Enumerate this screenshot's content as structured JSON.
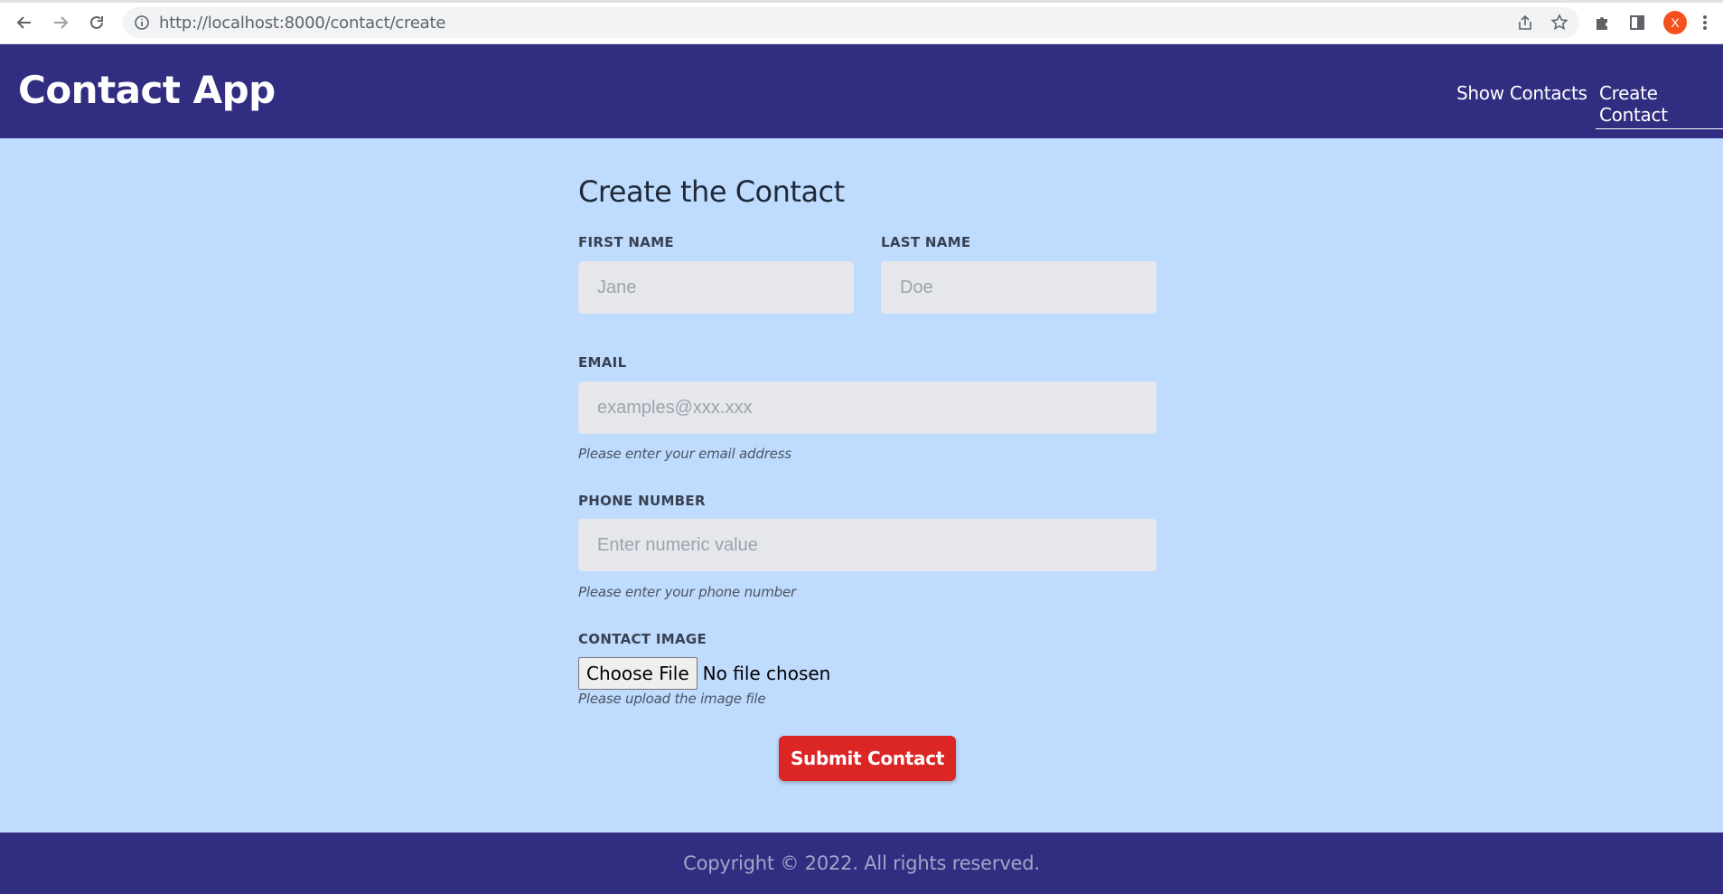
{
  "browser": {
    "url_host": "http://localhost",
    "url_rest": ":8000/contact/create",
    "profile_initial": "X"
  },
  "header": {
    "app_title": "Contact App",
    "nav": {
      "show_contacts": "Show Contacts",
      "create_contact": "Create Contact"
    }
  },
  "form": {
    "title": "Create the Contact",
    "first_name": {
      "label": "FIRST NAME",
      "placeholder": "Jane",
      "value": ""
    },
    "last_name": {
      "label": "LAST NAME",
      "placeholder": "Doe",
      "value": ""
    },
    "email": {
      "label": "EMAIL",
      "placeholder": "examples@xxx.xxx",
      "value": "",
      "hint": "Please enter your email address"
    },
    "phone": {
      "label": "PHONE NUMBER",
      "placeholder": "Enter numeric value",
      "value": "",
      "hint": "Please enter your phone number"
    },
    "image": {
      "label": "CONTACT IMAGE",
      "button": "Choose File",
      "status": "No file chosen",
      "hint": "Please upload the image file"
    },
    "submit_label": "Submit Contact"
  },
  "footer": {
    "copyright": "Copyright © 2022. All rights reserved."
  },
  "colors": {
    "header_bg": "#312e81",
    "main_bg": "#bfdbfe",
    "input_bg": "#e5e7eb",
    "submit_bg": "#dc2626"
  }
}
